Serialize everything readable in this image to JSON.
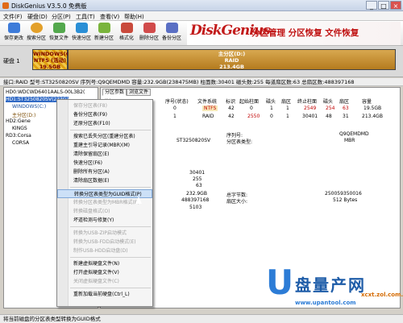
{
  "window": {
    "title": "DiskGenius V3.5.0 免费版",
    "min": "_",
    "max": "□",
    "close": "×"
  },
  "menu": [
    "文件(F)",
    "硬盘(D)",
    "分区(P)",
    "工具(T)",
    "查看(V)",
    "帮助(H)"
  ],
  "toolbar": [
    {
      "label": "保存更改",
      "icon": "save-icon",
      "color": "#3d7bd9"
    },
    {
      "label": "搜索分区",
      "icon": "search-icon",
      "color": "#e3a02a"
    },
    {
      "label": "恢复文件",
      "icon": "recover-icon",
      "color": "#53a84d"
    },
    {
      "label": "快速分区",
      "icon": "quick-partition-icon",
      "color": "#2a8fd6"
    },
    {
      "label": "新建分区",
      "icon": "new-partition-icon",
      "color": "#7ab43c"
    },
    {
      "label": "格式化",
      "icon": "format-icon",
      "color": "#c94a3c"
    },
    {
      "label": "删除分区",
      "icon": "delete-icon",
      "color": "#d14b4b"
    },
    {
      "label": "备份分区",
      "icon": "backup-icon",
      "color": "#5a6fc4"
    }
  ],
  "banner": {
    "logo": "DiskGenius",
    "slogan": "分区管理 分区恢复 文件恢复"
  },
  "diskbar": {
    "label": "硬盘 1",
    "seg1": [
      "WINDOWS(C:)",
      "NTFS (活动)",
      "19.5GB"
    ],
    "seg2": [
      "主分区(D:)",
      "RAID",
      "213.4GB"
    ]
  },
  "infoline": "接口:RAID  型号:ST3250820SV  序列号:Q9QEMDMD  容量:232.9GB(238475MB)  柱面数:30401  磁头数:255  每道扇区数:63  总扇区数:488397168",
  "tree": [
    "HD0:WDCWD6401AALS-00L3B2(",
    "HD1:ST3250820SV(233G)",
    "WINDOWS(C:)",
    "主分区(D:)",
    "HD2:Gene",
    "KINGS",
    "RD3:Corsa",
    "CORSA"
  ],
  "tabs": [
    "分区参数",
    "浏览文件"
  ],
  "table": {
    "headers": [
      "卷标",
      "序号(状态)",
      "文件系统",
      "标识",
      "起始柱面",
      "磁头",
      "扇区",
      "终止柱面",
      "磁头",
      "扇区",
      "容量"
    ],
    "rows": [
      [
        "",
        "0",
        "NTFS",
        "42",
        "0",
        "1",
        "1",
        "2549",
        "254",
        "63",
        "19.5GB"
      ],
      [
        "",
        "1",
        "RAID",
        "42",
        "2550",
        "0",
        "1",
        "30401",
        "48",
        "31",
        "213.4GB"
      ]
    ]
  },
  "details": {
    "model": "ST3250820SV",
    "serial_label": "序列号:",
    "serial": "Q9QEMDMD",
    "ptype_label": "分区表类型:",
    "ptype": "MBR",
    "cyl": "30401",
    "heads": "255",
    "sectors": "63",
    "cap": "232.9GB",
    "total_bytes_label": "总字节数:",
    "total_bytes": "250059350016",
    "total_sectors": "488397168",
    "sector_size_label": "扇区大小:",
    "sector_size": "512 Bytes",
    "extra": "5103"
  },
  "context_menu": {
    "items": [
      {
        "label": "保存分区表(F8)",
        "disabled": true,
        "icon": "save-icon"
      },
      {
        "label": "备份分区表(F9)",
        "disabled": false,
        "icon": "backup-icon"
      },
      {
        "label": "还原分区表(F10)",
        "disabled": false,
        "icon": "restore-icon"
      },
      {
        "sep": true
      },
      {
        "label": "搜索已丢失分区(重建分区表)",
        "disabled": false,
        "icon": "search-icon"
      },
      {
        "label": "重建主引导记录(MBR)(M)",
        "disabled": false,
        "icon": ""
      },
      {
        "label": "清除保留扇区(E)",
        "disabled": false,
        "icon": ""
      },
      {
        "label": "快速分区(F6)",
        "disabled": false,
        "icon": "quick-partition-icon"
      },
      {
        "label": "删除所有分区(A)",
        "disabled": false,
        "icon": ""
      },
      {
        "label": "清除扇区数据(E)",
        "disabled": false,
        "icon": ""
      },
      {
        "sep": true
      },
      {
        "label": "转换分区表类型为GUID格式(P)",
        "disabled": false,
        "icon": "",
        "highlight": true
      },
      {
        "label": "转换分区表类型为MBR格式(B)",
        "disabled": true,
        "icon": ""
      },
      {
        "label": "转换磁盘格式(O)",
        "disabled": true,
        "icon": ""
      },
      {
        "label": "坏道检测与修复(Y)",
        "disabled": false,
        "icon": ""
      },
      {
        "sep": true
      },
      {
        "label": "转换为USB-ZIP启动模式",
        "disabled": true,
        "icon": ""
      },
      {
        "label": "转换为USB-FDD启动模式(E)",
        "disabled": true,
        "icon": ""
      },
      {
        "label": "制作USB-HDD启动盘(D)",
        "disabled": true,
        "icon": ""
      },
      {
        "sep": true
      },
      {
        "label": "新建虚拟硬盘文件(N)",
        "disabled": false,
        "icon": ""
      },
      {
        "label": "打开虚拟硬盘文件(V)",
        "disabled": false,
        "icon": ""
      },
      {
        "label": "关闭虚拟硬盘文件(C)",
        "disabled": true,
        "icon": ""
      },
      {
        "sep": true
      },
      {
        "label": "重新加载当前硬盘(Ctrl_L)",
        "disabled": false,
        "icon": ""
      }
    ]
  },
  "statusbar": "将当前磁盘的分区表类型转换为GUID格式",
  "watermark": {
    "u": "U",
    "name": "盘量产网",
    "url": "www.upantool.com",
    "tag": "xcxt.zol.com.cn"
  }
}
